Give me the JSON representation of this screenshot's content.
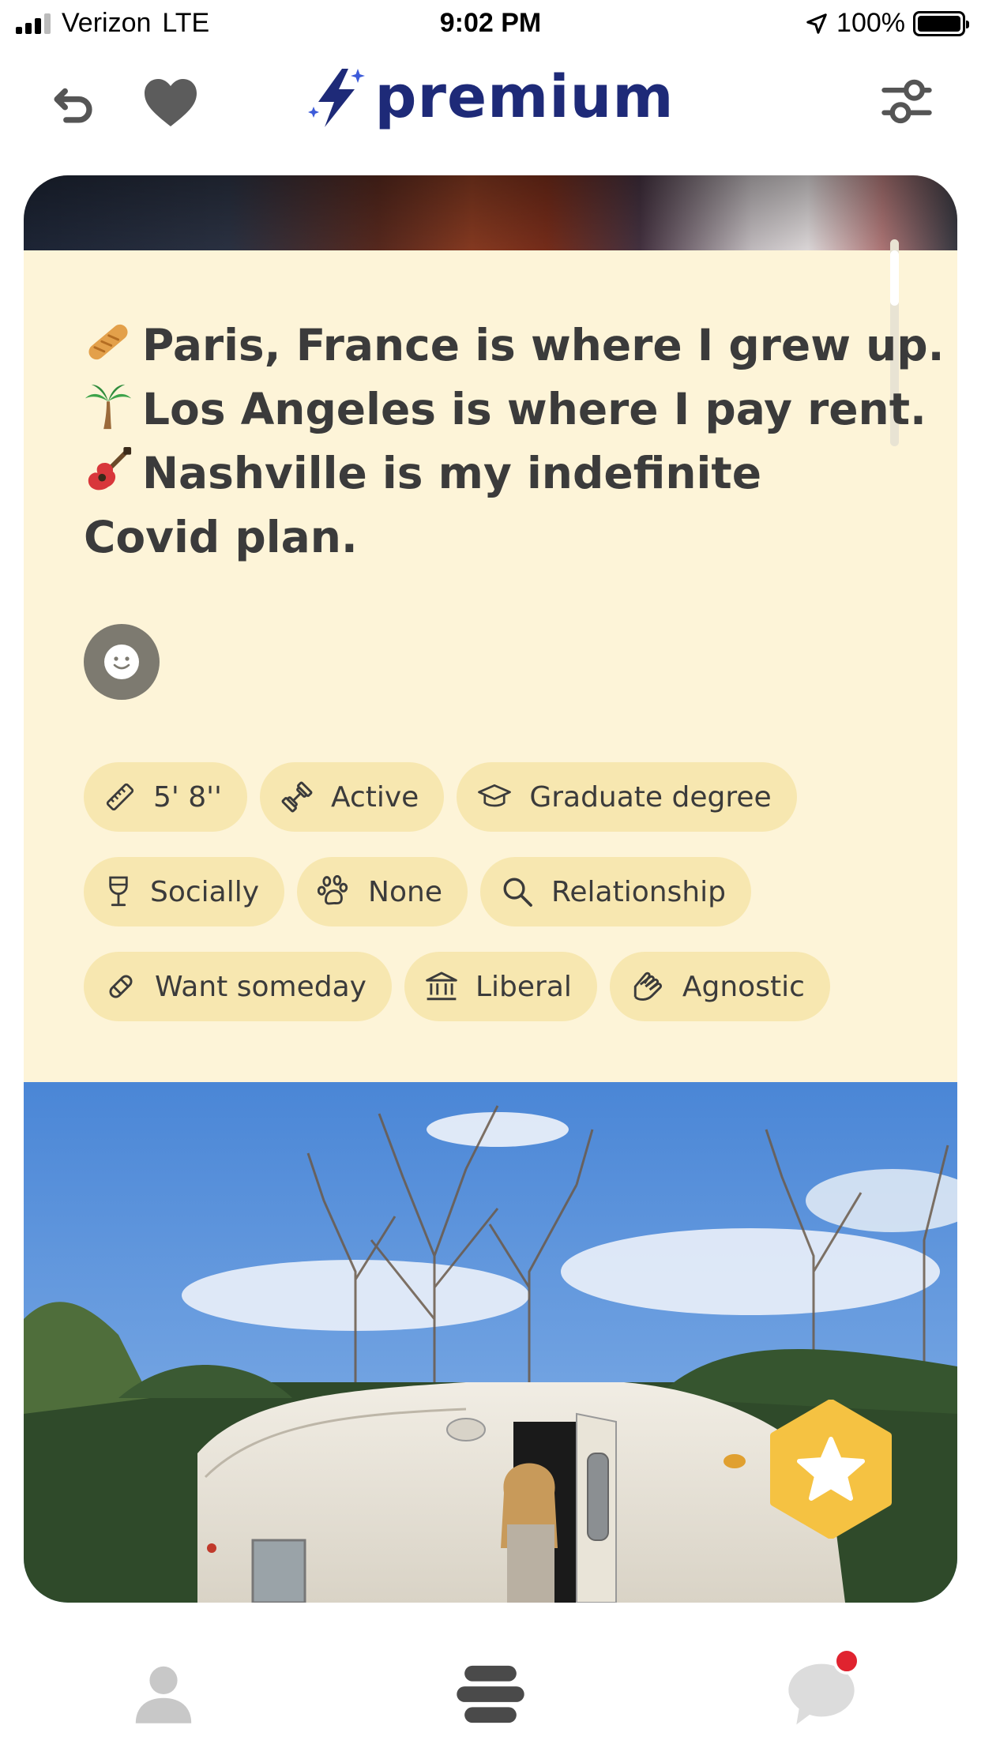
{
  "status_bar": {
    "carrier": "Verizon",
    "network": "LTE",
    "time": "9:02 PM",
    "battery": "100%"
  },
  "nav": {
    "brand": "premium",
    "icons": [
      "undo-icon",
      "heart-icon",
      "filters-icon"
    ]
  },
  "bio": {
    "lines": [
      {
        "emoji": "baguette",
        "text": "Paris, France is where I grew up."
      },
      {
        "emoji": "palm-tree",
        "text": "Los Angeles is where I pay rent."
      },
      {
        "emoji": "guitar",
        "text": "Nashville is my indefinite"
      },
      {
        "emoji": "",
        "text": "Covid plan."
      }
    ]
  },
  "tags": {
    "height": "5' 8''",
    "exercise": "Active",
    "education": "Graduate degree",
    "drinking": "Socially",
    "pets": "None",
    "looking_for": "Relationship",
    "kids": "Want someday",
    "politics": "Liberal",
    "religion": "Agnostic"
  },
  "tab_bar": {
    "icons": [
      "profile-icon",
      "discover-icon",
      "chat-icon"
    ],
    "chat_has_notification": true
  },
  "colors": {
    "brand": "#1e2a78",
    "card_bg": "#fdf4d8",
    "tag_bg": "#f7e7b0",
    "star_badge": "#f5c242",
    "notification": "#e0232f"
  }
}
